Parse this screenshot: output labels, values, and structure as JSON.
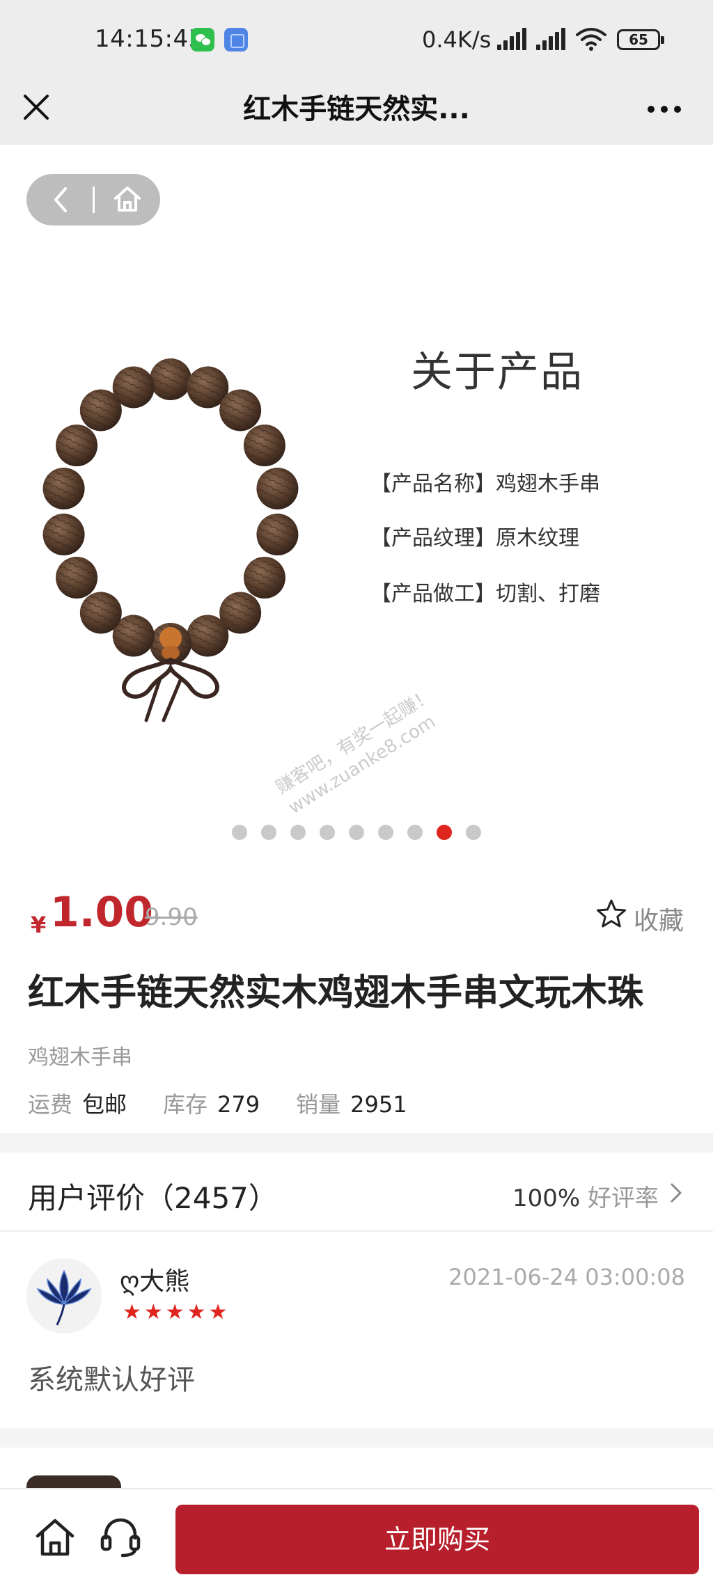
{
  "status_bar": {
    "time": "14:15:45",
    "app_icons": [
      "wechat-icon",
      "app-icon"
    ],
    "network_speed": "0.4K/s",
    "battery": "65"
  },
  "title_bar": {
    "title": "红木手链天然实...",
    "close_icon": "close-icon",
    "more_icon": "more-icon"
  },
  "nav_pill": {
    "back_icon": "back-icon",
    "home_icon": "home-icon"
  },
  "product_image": {
    "heading": "关于产品",
    "specs": [
      "【产品名称】鸡翅木手串",
      "【产品纹理】原木纹理",
      "【产品做工】切割、打磨"
    ],
    "slide_count": 9,
    "active_slide": 8,
    "watermark_line1": "赚客吧，有奖一起赚！",
    "watermark_line2": "www.zuanke8.com"
  },
  "product": {
    "currency": "¥",
    "price": "1.00",
    "original_price": "9.90",
    "favorite_label": "收藏",
    "title": "红木手链天然实木鸡翅木手串文玩木珠",
    "subtitle": "鸡翅木手串",
    "shipping_label": "运费",
    "shipping_value": "包邮",
    "stock_label": "库存",
    "stock_value": "279",
    "sales_label": "销量",
    "sales_value": "2951"
  },
  "reviews": {
    "title": "用户评价（2457）",
    "rate_value": "100%",
    "rate_label": "好评率",
    "items": [
      {
        "user": "ღ大熊",
        "stars": "★★★★★",
        "rating": 5,
        "time": "2021-06-24 03:00:08",
        "text": "系统默认好评"
      }
    ]
  },
  "bottom_bar": {
    "home_icon": "home-icon",
    "service_icon": "customer-service-icon",
    "buy_label": "立即购买"
  },
  "colors": {
    "accent_red": "#c0272d",
    "buy_button": "#b81f2c",
    "dot_active": "#e0241e"
  }
}
